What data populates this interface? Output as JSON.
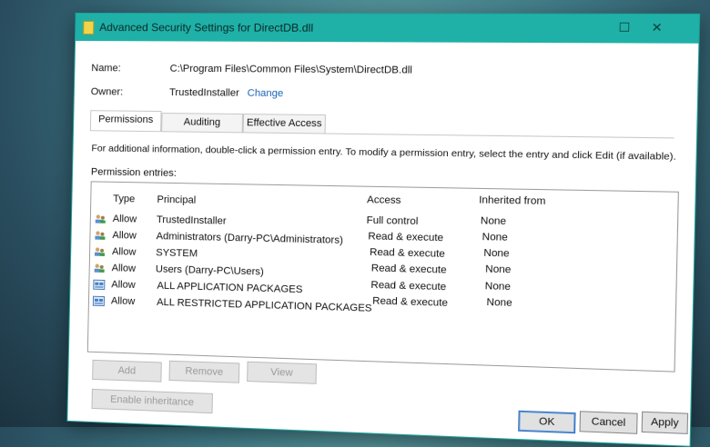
{
  "window": {
    "title": "Advanced Security Settings for DirectDB.dll",
    "maximize_glyph": "☐",
    "close_glyph": "✕"
  },
  "info": {
    "name_label": "Name:",
    "name_value": "C:\\Program Files\\Common Files\\System\\DirectDB.dll",
    "owner_label": "Owner:",
    "owner_value": "TrustedInstaller",
    "change_link": "Change"
  },
  "tabs": [
    {
      "label": "Permissions",
      "active": true
    },
    {
      "label": "Auditing",
      "active": false
    },
    {
      "label": "Effective Access",
      "active": false
    }
  ],
  "description": "For additional information, double-click a permission entry. To modify a permission entry, select the entry and click Edit (if available).",
  "entries_label": "Permission entries:",
  "columns": {
    "type": "Type",
    "principal": "Principal",
    "access": "Access",
    "inherited": "Inherited from"
  },
  "entries": [
    {
      "icon": "user-group-icon",
      "type": "Allow",
      "principal": "TrustedInstaller",
      "access": "Full control",
      "inherited": "None"
    },
    {
      "icon": "user-group-icon",
      "type": "Allow",
      "principal": "Administrators (Darry-PC\\Administrators)",
      "access": "Read & execute",
      "inherited": "None"
    },
    {
      "icon": "user-group-icon",
      "type": "Allow",
      "principal": "SYSTEM",
      "access": "Read & execute",
      "inherited": "None"
    },
    {
      "icon": "user-group-icon",
      "type": "Allow",
      "principal": "Users (Darry-PC\\Users)",
      "access": "Read & execute",
      "inherited": "None"
    },
    {
      "icon": "app-package-icon",
      "type": "Allow",
      "principal": "ALL APPLICATION PACKAGES",
      "access": "Read & execute",
      "inherited": "None"
    },
    {
      "icon": "app-package-icon",
      "type": "Allow",
      "principal": "ALL RESTRICTED APPLICATION PACKAGES",
      "access": "Read & execute",
      "inherited": "None"
    }
  ],
  "buttons": {
    "add": "Add",
    "remove": "Remove",
    "view": "View",
    "enable_inheritance": "Enable inheritance",
    "ok": "OK",
    "cancel": "Cancel",
    "apply": "Apply"
  },
  "colors": {
    "titlebar": "#1fb1a7",
    "link": "#1a63b5"
  }
}
